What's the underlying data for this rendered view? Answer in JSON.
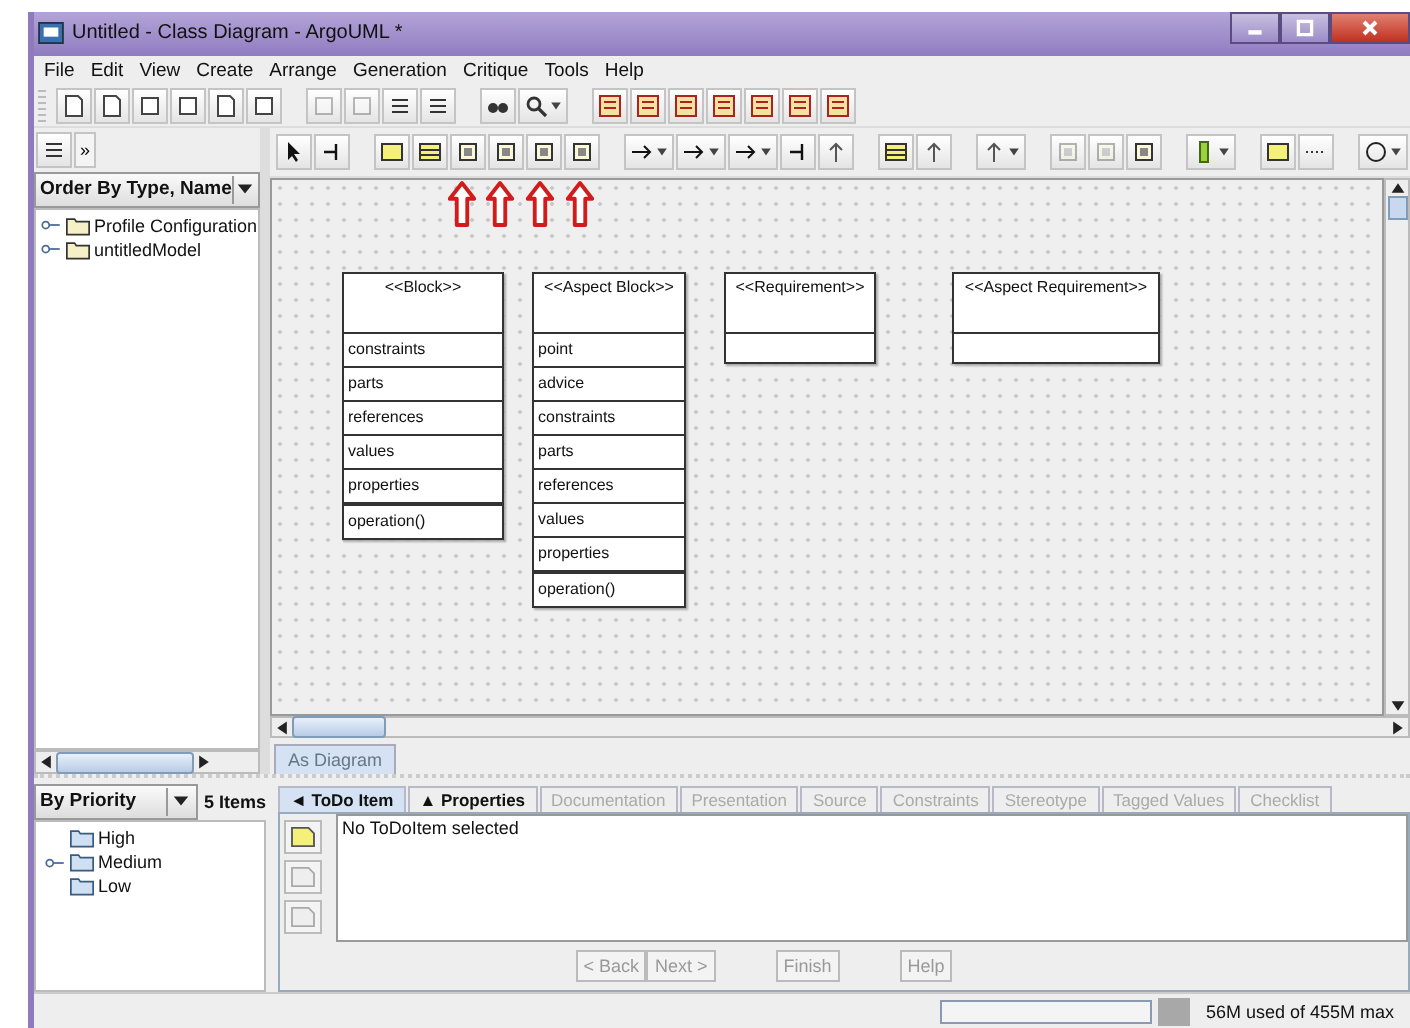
{
  "window": {
    "title": "Untitled - Class Diagram - ArgoUML *"
  },
  "menu": [
    "File",
    "Edit",
    "View",
    "Create",
    "Arrange",
    "Generation",
    "Critique",
    "Tools",
    "Help"
  ],
  "explorer": {
    "more": "»",
    "perspective": "Order By Type, Name",
    "tree": [
      {
        "label": "Profile Configuration",
        "expanded": false
      },
      {
        "label": "untitledModel",
        "expanded": false
      }
    ]
  },
  "diagram": {
    "classes": [
      {
        "stereotype": "<<Block>>",
        "attributes": [
          "constraints",
          "parts",
          "references",
          "values",
          "properties"
        ],
        "operations": [
          "operation()"
        ]
      },
      {
        "stereotype": "<<Aspect Block>>",
        "attributes": [
          "point",
          "advice",
          "constraints",
          "parts",
          "references",
          "values",
          "properties"
        ],
        "operations": [
          "operation()"
        ]
      },
      {
        "stereotype": "<<Requirement>>"
      },
      {
        "stereotype": "<<Aspect Requirement>>"
      }
    ],
    "tabs": [
      {
        "label": "As Diagram",
        "selected": true
      }
    ]
  },
  "todo": {
    "ordering": "By Priority",
    "count": "5 Items",
    "tree": [
      {
        "label": "High",
        "has_children": false
      },
      {
        "label": "Medium",
        "expanded": false,
        "has_children": true
      },
      {
        "label": "Low",
        "has_children": false
      }
    ]
  },
  "details": {
    "tabs": [
      {
        "label": "◄ ToDo Item",
        "selected": true,
        "disabled": false
      },
      {
        "label": "▲ Properties",
        "selected": false,
        "disabled": false
      },
      {
        "label": "Documentation",
        "selected": false,
        "disabled": true
      },
      {
        "label": "Presentation",
        "selected": false,
        "disabled": true
      },
      {
        "label": "Source",
        "selected": false,
        "disabled": true
      },
      {
        "label": "Constraints",
        "selected": false,
        "disabled": true
      },
      {
        "label": "Stereotype",
        "selected": false,
        "disabled": true
      },
      {
        "label": "Tagged Values",
        "selected": false,
        "disabled": true
      },
      {
        "label": "Checklist",
        "selected": false,
        "disabled": true
      }
    ],
    "message": "No ToDoItem selected",
    "buttons": [
      {
        "label": "< Back",
        "disabled": true
      },
      {
        "label": "Next >",
        "disabled": true
      },
      {
        "label": "Finish",
        "disabled": true
      },
      {
        "label": "Help",
        "disabled": true
      }
    ]
  },
  "status_bar": {
    "memory": "56M used of 455M max"
  }
}
